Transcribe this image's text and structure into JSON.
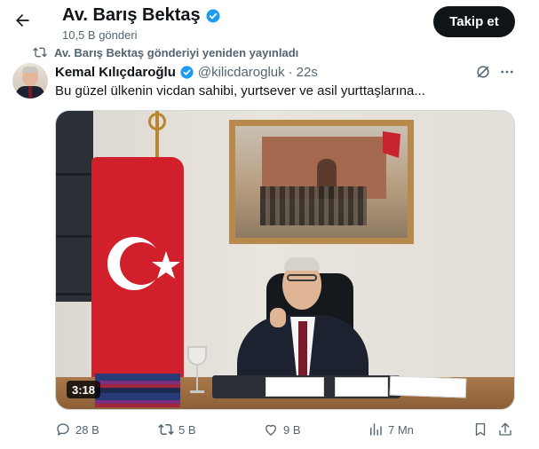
{
  "header": {
    "back_icon": "arrow-left-icon",
    "profile_name": "Av. Barış Bektaş",
    "post_count": "10,5 B gönderi",
    "follow_label": "Takip et"
  },
  "repost_notice": "Av. Barış Bektaş gönderiyi yeniden yayınladı",
  "tweet": {
    "author_name": "Kemal Kılıçdaroğlu",
    "author_handle": "@kilicdarogluk",
    "separator": "·",
    "time": "22s",
    "text": "Bu güzel ülkenin vicdan sahibi, yurtsever ve asil yurttaşlarına...",
    "video_duration": "3:18"
  },
  "actions": {
    "replies": "28 B",
    "reposts": "5 B",
    "likes": "9 B",
    "views": "7 Mn"
  },
  "colors": {
    "accent": "#1d9bf0",
    "text_primary": "#0f1419",
    "text_secondary": "#536471",
    "follow_bg": "#0f1419"
  },
  "icons": [
    "arrow-left-icon",
    "verified-badge-icon",
    "repost-icon",
    "grok-icon",
    "more-icon",
    "reply-icon",
    "like-icon",
    "views-icon",
    "bookmark-icon",
    "share-icon"
  ]
}
